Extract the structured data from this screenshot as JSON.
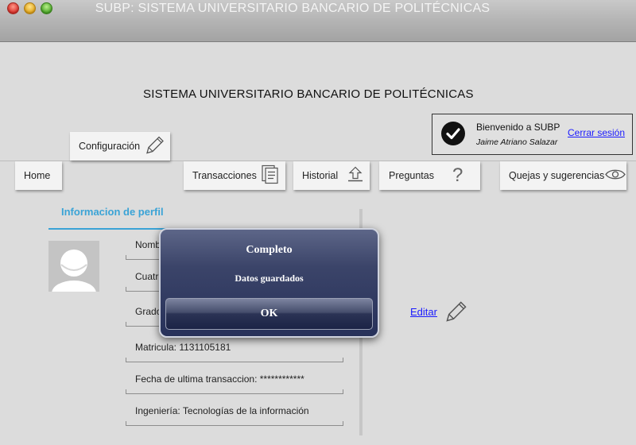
{
  "window": {
    "title": "SUBP: SISTEMA UNIVERSITARIO BANCARIO DE POLITÉCNICAS"
  },
  "header": {
    "heading": "SISTEMA UNIVERSITARIO BANCARIO DE POLITÉCNICAS"
  },
  "welcome": {
    "greeting": "Bienvenido a SUBP",
    "user_name": "Jaime Atriano Salazar",
    "logout": "Cerrar sesión"
  },
  "nav": {
    "config": "Configuración",
    "home": "Home",
    "transacciones": "Transacciones",
    "historial": "Historial",
    "preguntas": "Preguntas",
    "quejas": "Quejas y sugerencias"
  },
  "profile": {
    "section_title": "Informacion de perfil",
    "fields": [
      "Nombre: Jaime Atriano Salazar",
      "Cuatrimestre: 8vo",
      "Grado: ",
      "Matricula: 1131105181",
      "Fecha de ultima transaccion: ************",
      "Ingeniería: Tecnologías de la información"
    ],
    "edit": "Editar"
  },
  "dialog": {
    "title": "Completo",
    "message": "Datos guardados",
    "ok": "OK"
  },
  "icons": [
    "pencil-icon",
    "document-icon",
    "upload-icon",
    "question-icon",
    "eye-icon",
    "check-icon"
  ],
  "colors": {
    "accent": "#3aa3d6",
    "link": "#1a1aff",
    "dialog_bg": "#2f3960"
  }
}
